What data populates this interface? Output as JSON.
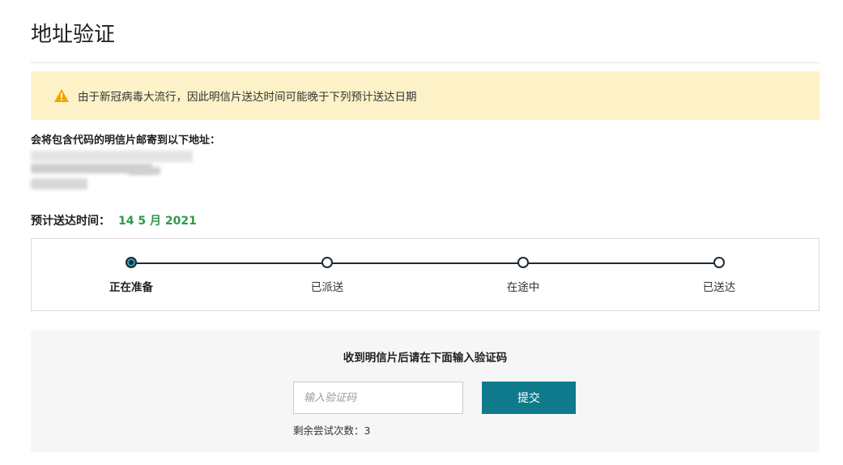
{
  "page": {
    "title": "地址验证"
  },
  "warning": {
    "text": "由于新冠病毒大流行，因此明信片送达时间可能晚于下列预计送达日期",
    "icon": "warning-icon",
    "background": "#fdf2c7",
    "icon_color": "#f0a500"
  },
  "mailing": {
    "label": "会将包含代码的明信片邮寄到以下地址："
  },
  "eta": {
    "label": "预计送达时间：",
    "value": "14 5 月 2021",
    "color": "#2e9a4a"
  },
  "tracker": {
    "steps": [
      {
        "label": "正在准备",
        "active": true
      },
      {
        "label": "已派送",
        "active": false
      },
      {
        "label": "在途中",
        "active": false
      },
      {
        "label": "已送达",
        "active": false
      }
    ]
  },
  "verify": {
    "title": "收到明信片后请在下面输入验证码",
    "input_placeholder": "输入验证码",
    "input_value": "",
    "submit_label": "提交",
    "submit_color": "#0f7a8c",
    "attempts_text": "剩余尝试次数：3"
  }
}
